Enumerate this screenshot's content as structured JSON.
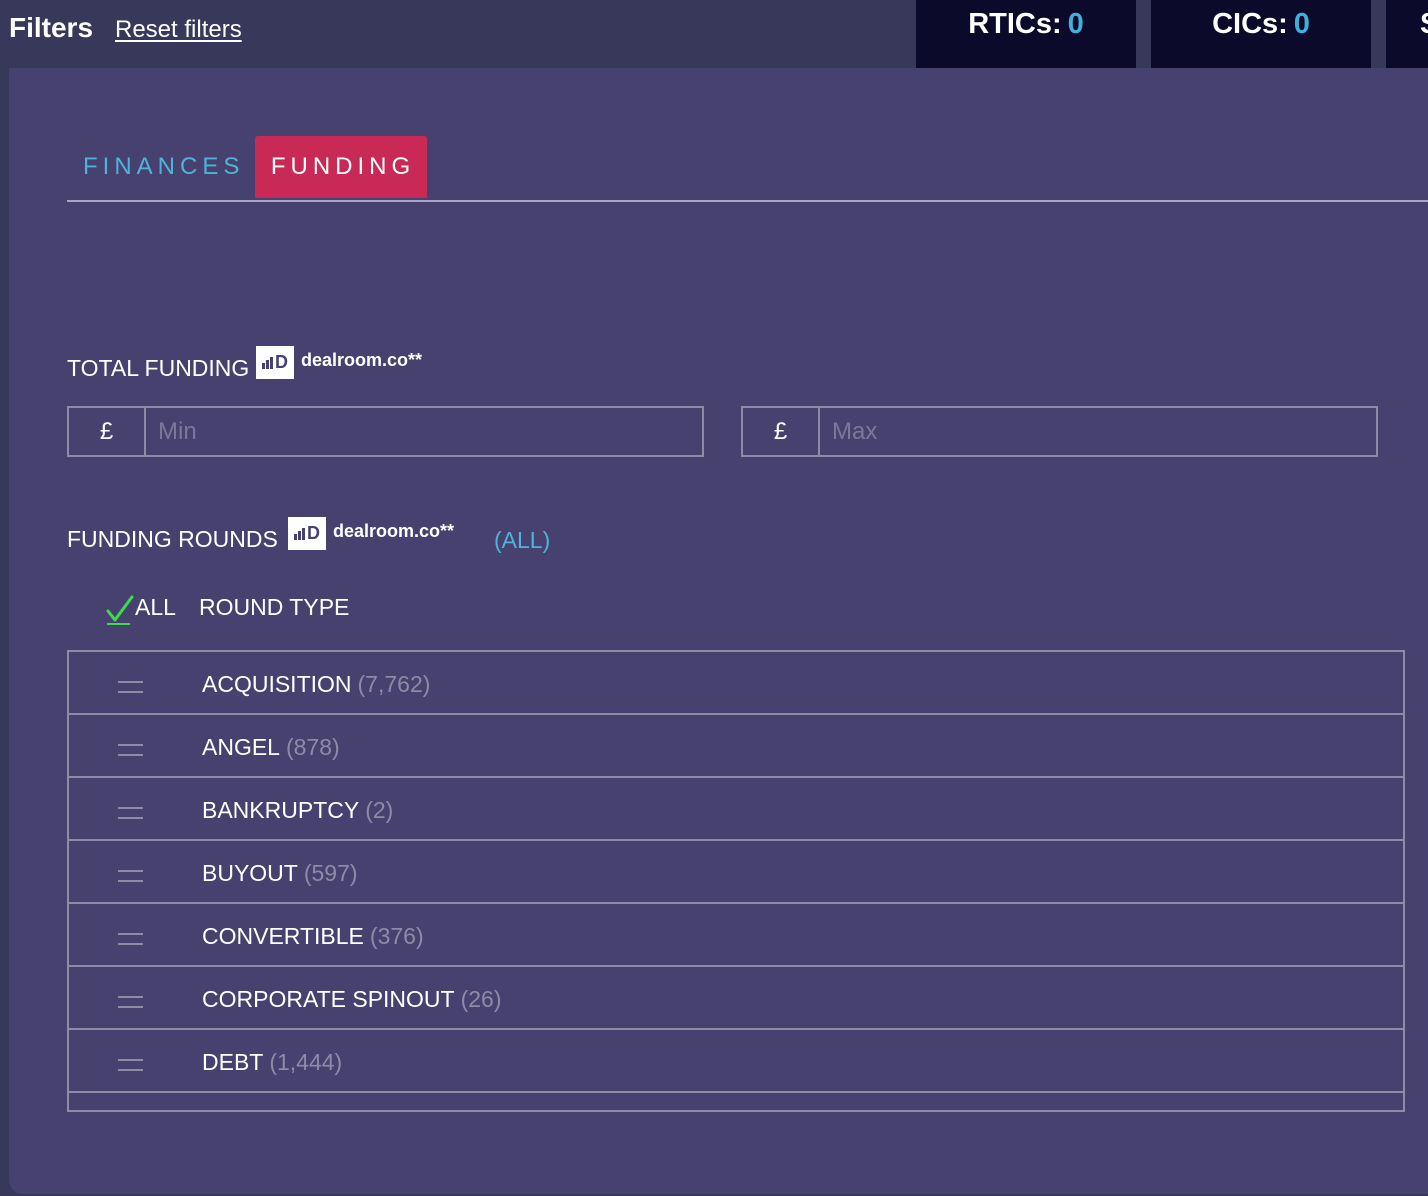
{
  "header": {
    "title": "Filters",
    "reset_label": "Reset filters",
    "stats": [
      {
        "label": "RTICs:",
        "value": "0"
      },
      {
        "label": "CICs:",
        "value": "0"
      },
      {
        "label": "S",
        "value": ""
      }
    ]
  },
  "tabs": [
    {
      "label": "FINANCES",
      "active": false
    },
    {
      "label": "FUNDING",
      "active": true
    }
  ],
  "total_funding": {
    "label": "TOTAL FUNDING",
    "source_logo": "dealroom.co**",
    "min": {
      "currency": "£",
      "placeholder": "Min",
      "value": ""
    },
    "max": {
      "currency": "£",
      "placeholder": "Max",
      "value": ""
    }
  },
  "funding_rounds": {
    "label": "FUNDING ROUNDS",
    "source_logo": "dealroom.co**",
    "all_link": "(ALL)",
    "select_all_label": "ALL",
    "column_label": "ROUND TYPE",
    "rounds": [
      {
        "name": "ACQUISITION",
        "count": "(7,762)"
      },
      {
        "name": "ANGEL",
        "count": "(878)"
      },
      {
        "name": "BANKRUPTCY",
        "count": "(2)"
      },
      {
        "name": "BUYOUT",
        "count": "(597)"
      },
      {
        "name": "CONVERTIBLE",
        "count": "(376)"
      },
      {
        "name": "CORPORATE SPINOUT",
        "count": "(26)"
      },
      {
        "name": "DEBT",
        "count": "(1,444)"
      }
    ]
  },
  "colors": {
    "panel": "#47416f",
    "topbar": "#38385a",
    "stat_card": "#0c0a2a",
    "accent_blue": "#4fb3d9",
    "accent_red": "#c92a55",
    "check_green": "#3ddc4a"
  }
}
